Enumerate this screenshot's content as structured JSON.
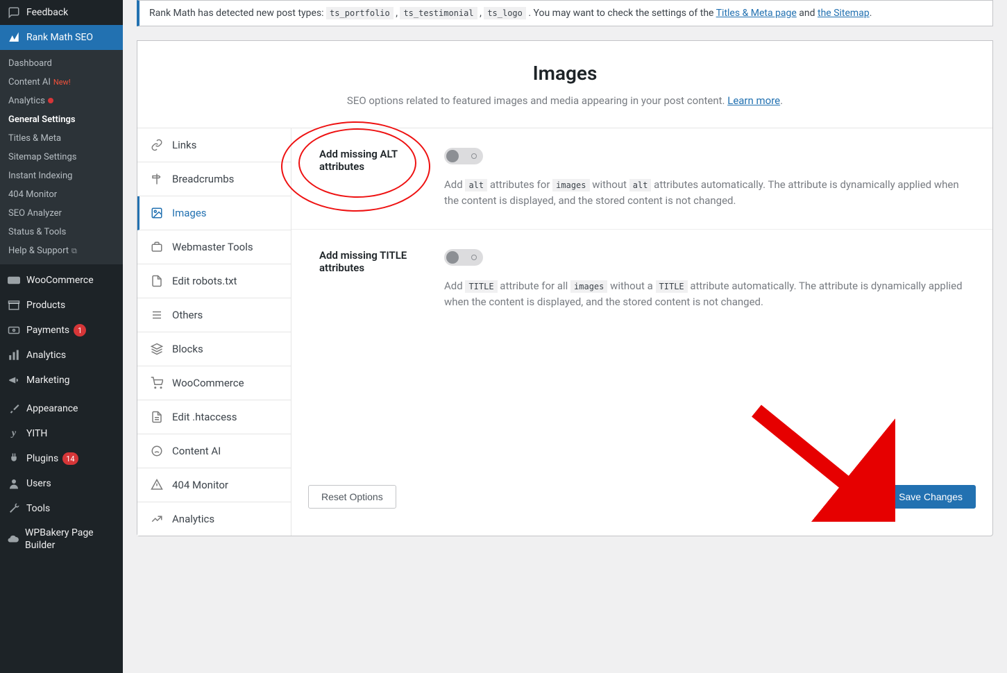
{
  "sidebar": {
    "feedback": "Feedback",
    "rankmath": "Rank Math SEO",
    "submenu": [
      {
        "label": "Dashboard"
      },
      {
        "label": "Content AI",
        "badge_new": "New!"
      },
      {
        "label": "Analytics",
        "dot": true
      },
      {
        "label": "General Settings",
        "current": true
      },
      {
        "label": "Titles & Meta"
      },
      {
        "label": "Sitemap Settings"
      },
      {
        "label": "Instant Indexing"
      },
      {
        "label": "404 Monitor"
      },
      {
        "label": "SEO Analyzer"
      },
      {
        "label": "Status & Tools"
      },
      {
        "label": "Help & Support",
        "ext": true
      }
    ],
    "woocommerce": "WooCommerce",
    "products": "Products",
    "payments": "Payments",
    "payments_badge": "1",
    "analytics": "Analytics",
    "marketing": "Marketing",
    "appearance": "Appearance",
    "yith": "YITH",
    "plugins": "Plugins",
    "plugins_badge": "14",
    "users": "Users",
    "tools": "Tools",
    "wpbakery": "WPBakery Page Builder"
  },
  "notice": {
    "prefix": "Rank Math has detected new post types: ",
    "codes": [
      "ts_portfolio",
      "ts_testimonial",
      "ts_logo"
    ],
    "mid": ". You may want to check the settings of the ",
    "link1": "Titles & Meta page",
    "and": " and ",
    "link2": "the Sitemap",
    "suffix": "."
  },
  "header": {
    "title": "Images",
    "desc_pre": "SEO options related to featured images and media appearing in your post content. ",
    "learn_more": "Learn more",
    "desc_post": "."
  },
  "tabs": [
    {
      "label": "Links"
    },
    {
      "label": "Breadcrumbs"
    },
    {
      "label": "Images",
      "active": true
    },
    {
      "label": "Webmaster Tools"
    },
    {
      "label": "Edit robots.txt"
    },
    {
      "label": "Others"
    },
    {
      "label": "Blocks"
    },
    {
      "label": "WooCommerce"
    },
    {
      "label": "Edit .htaccess"
    },
    {
      "label": "Content AI"
    },
    {
      "label": "404 Monitor"
    },
    {
      "label": "Analytics"
    }
  ],
  "settings": {
    "alt": {
      "label": "Add missing ALT attributes",
      "desc_parts": [
        "Add ",
        "alt",
        " attributes for ",
        "images",
        " without ",
        "alt",
        " attributes automatically. The attribute is dynamically applied when the content is displayed, and the stored content is not changed."
      ]
    },
    "title": {
      "label": "Add missing TITLE attributes",
      "desc_parts": [
        "Add ",
        "TITLE",
        " attribute for all ",
        "images",
        " without a ",
        "TITLE",
        " attribute automatically. The attribute is dynamically applied when the content is displayed, and the stored content is not changed."
      ]
    }
  },
  "footer": {
    "reset": "Reset Options",
    "save": "Save Changes"
  }
}
